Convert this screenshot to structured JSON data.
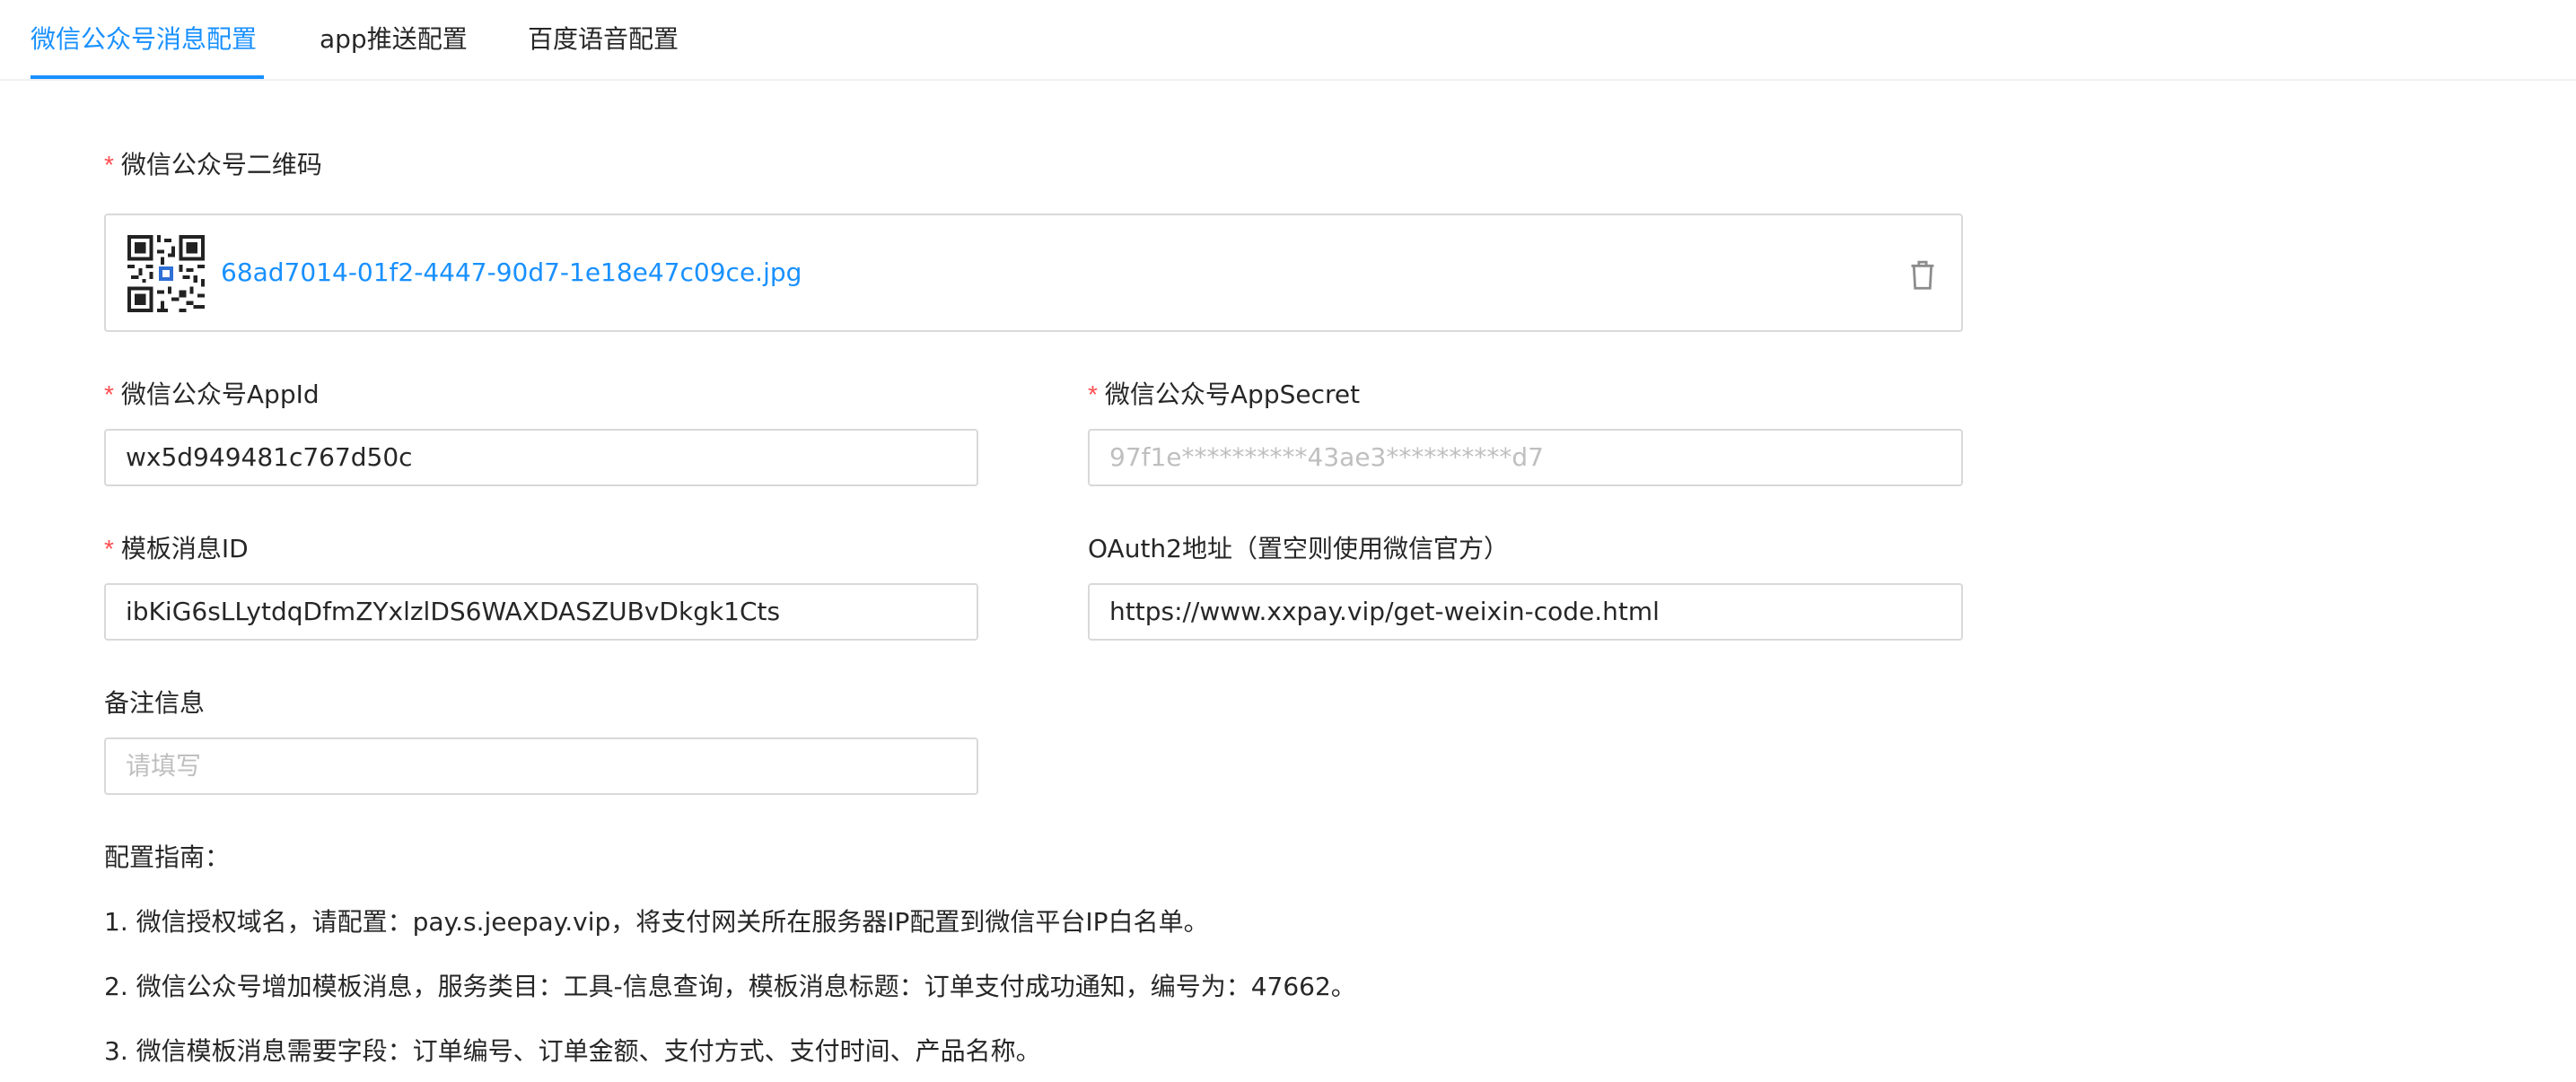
{
  "tabs": [
    {
      "label": "微信公众号消息配置",
      "active": true
    },
    {
      "label": "app推送配置",
      "active": false
    },
    {
      "label": "百度语音配置",
      "active": false
    }
  ],
  "form": {
    "required_mark": "*",
    "qrcode": {
      "label": "微信公众号二维码",
      "file_name": "68ad7014-01f2-4447-90d7-1e18e47c09ce.jpg",
      "delete_icon": "trash-icon"
    },
    "appid": {
      "label": "微信公众号AppId",
      "value": "wx5d949481c767d50c"
    },
    "appsecret": {
      "label": "微信公众号AppSecret",
      "placeholder": "97f1e**********43ae3**********d7"
    },
    "template_id": {
      "label": "模板消息ID",
      "value": "ibKiG6sLLytdqDfmZYxlzlDS6WAXDASZUBvDkgk1Cts"
    },
    "oauth2": {
      "label": "OAuth2地址（置空则使用微信官方）",
      "value": "https://www.xxpay.vip/get-weixin-code.html"
    },
    "remark": {
      "label": "备注信息",
      "placeholder": "请填写"
    }
  },
  "guide": {
    "title": "配置指南：",
    "items": [
      "1. 微信授权域名，请配置：pay.s.jeepay.vip，将支付网关所在服务器IP配置到微信平台IP白名单。",
      "2. 微信公众号增加模板消息，服务类目：工具-信息查询，模板消息标题：订单支付成功通知，编号为：47662。",
      "3. 微信模板消息需要字段：订单编号、订单金额、支付方式、支付时间、产品名称。"
    ]
  },
  "colors": {
    "primary": "#1890ff",
    "required": "#ff4d4f",
    "border": "#d9d9d9",
    "placeholder": "#bfbfbf"
  }
}
